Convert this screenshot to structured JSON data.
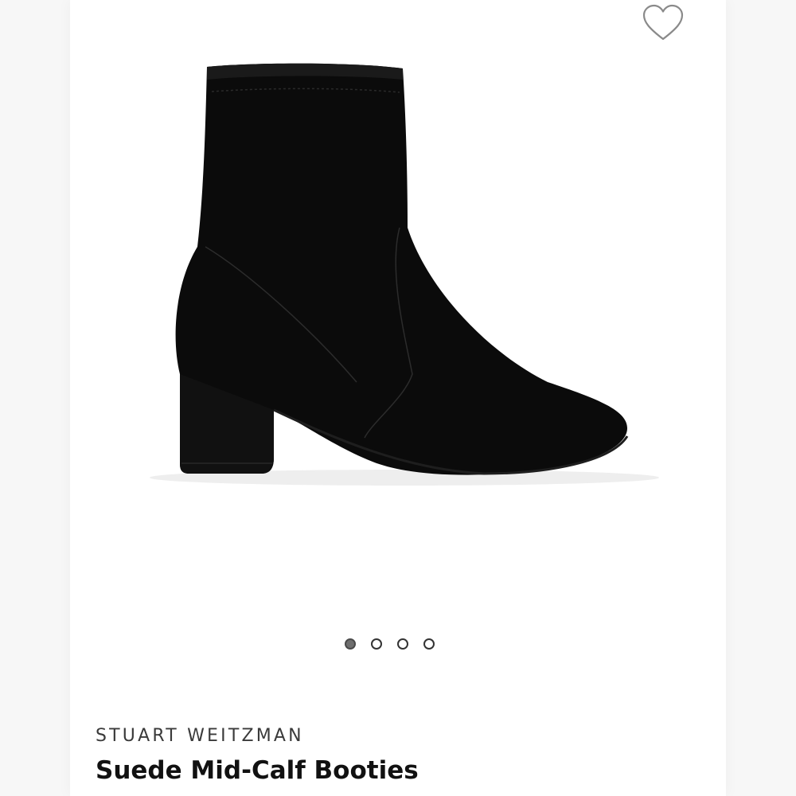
{
  "product": {
    "brand": "STUART WEITZMAN",
    "name": "Suede Mid-Calf Booties",
    "image_icon": "boot-image"
  },
  "favorite": {
    "icon": "heart-outline-icon"
  },
  "carousel": {
    "count": 4,
    "active_index": 0
  },
  "colors": {
    "boot": "#0b0b0b",
    "accent_dot": "#6e6e6e"
  }
}
